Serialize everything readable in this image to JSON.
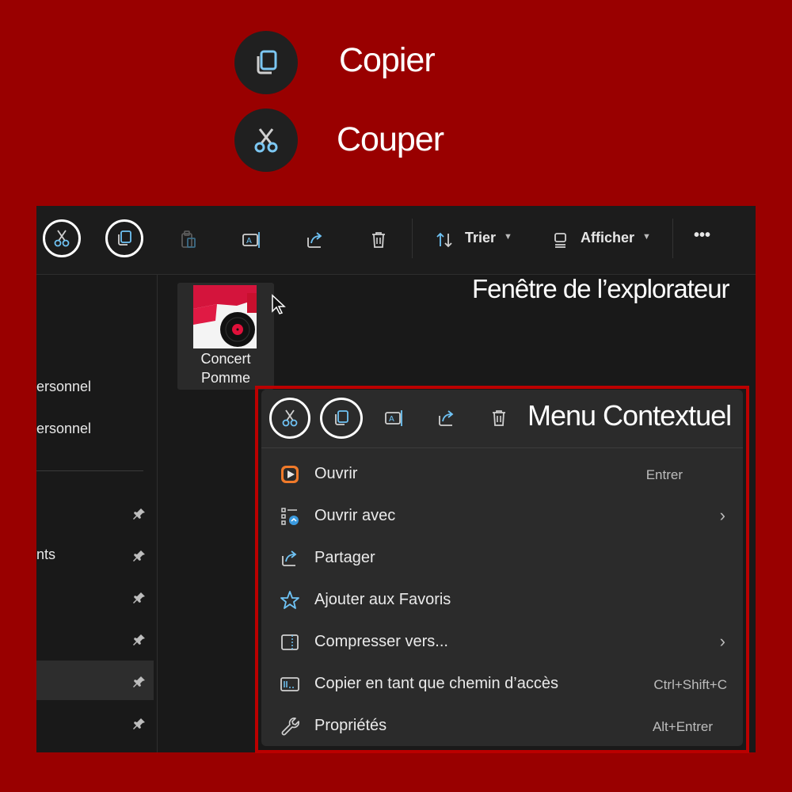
{
  "legend": {
    "copy_label": "Copier",
    "cut_label": "Couper"
  },
  "explorer": {
    "caption": "Fenêtre de l’explorateur",
    "toolbar": {
      "sort_label": "Trier",
      "view_label": "Afficher",
      "more_label": "•••"
    },
    "nav": {
      "items": [
        {
          "label": "ersonnel"
        },
        {
          "label": "ersonnel"
        },
        {
          "label": "nts"
        }
      ]
    },
    "file": {
      "name_line1": "Concert",
      "name_line2": "Pomme"
    }
  },
  "context_menu": {
    "caption": "Menu Contextuel",
    "items": [
      {
        "label": "Ouvrir",
        "shortcut": "Entrer"
      },
      {
        "label": "Ouvrir avec",
        "arrow": "›"
      },
      {
        "label": "Partager"
      },
      {
        "label": "Ajouter aux Favoris"
      },
      {
        "label": "Compresser vers...",
        "arrow": "›"
      },
      {
        "label": "Copier en tant que chemin d’accès",
        "shortcut": "Ctrl+Shift+C"
      },
      {
        "label": "Propriétés",
        "shortcut": "Alt+Entrer"
      }
    ]
  },
  "colors": {
    "background": "#990000",
    "highlight_frame": "#bb0000",
    "icon_accent": "#6fc3f5"
  }
}
